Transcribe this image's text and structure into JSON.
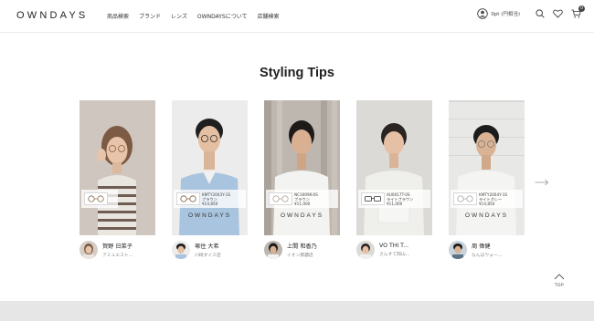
{
  "header": {
    "logo": "OWNDAYS",
    "nav": [
      "商品検索",
      "ブランド",
      "レンズ",
      "OWNDAYSについて",
      "店舗検索"
    ],
    "points": "0pt (円相当)",
    "icons": [
      "user-icon",
      "search-icon",
      "heart-icon",
      "cart-icon"
    ],
    "cart_count": "0"
  },
  "section": {
    "title": "Styling Tips"
  },
  "cards": [
    {
      "tag_lines": [
        "",
        "",
        ""
      ],
      "brand": "",
      "name": "賀野 日菜子",
      "store": "アミュエスト..."
    },
    {
      "tag_lines": [
        "KMTY2003Y-1S",
        "ブラウン",
        "¥14,850"
      ],
      "brand": "OWNDAYS",
      "name": "塚住 大希",
      "store": "川崎ダイス店"
    },
    {
      "tag_lines": [
        "NC3009K-0S",
        "ブラウン",
        "¥11,000"
      ],
      "brand": "OWNDAYS",
      "name": "上間 和香乃",
      "store": "イオン那覇店"
    },
    {
      "tag_lines": [
        "AU0017T-0S",
        "ライトブラウン",
        "¥11,000"
      ],
      "brand": "",
      "name": "VO THI T...",
      "store": "さんすて岡山..."
    },
    {
      "tag_lines": [
        "KMTY2004Y-1S",
        "ライトグレー",
        "¥14,850"
      ],
      "brand": "OWNDAYS",
      "name": "周 偉健",
      "store": "なんばウォー..."
    }
  ],
  "to_top": "TOP",
  "colors": {
    "accent": "#333333",
    "footer": "#e6e6e6"
  }
}
